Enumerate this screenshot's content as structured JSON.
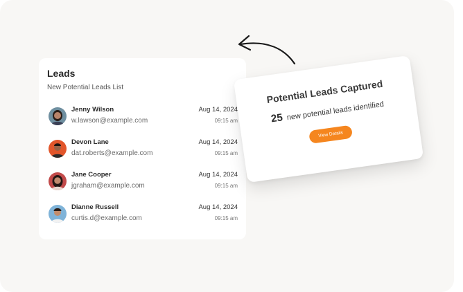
{
  "leads": {
    "title": "Leads",
    "subtitle": "New Potential Leads List",
    "rows": [
      {
        "name": "Jenny Wilson",
        "email": "w.lawson@example.com",
        "date": "Aug 14, 2024",
        "time": "09:15 am"
      },
      {
        "name": "Devon Lane",
        "email": "dat.roberts@example.com",
        "date": "Aug 14, 2024",
        "time": "09:15 am"
      },
      {
        "name": "Jane Cooper",
        "email": "jgraham@example.com",
        "date": "Aug 14, 2024",
        "time": "09:15 am"
      },
      {
        "name": "Dianne Russell",
        "email": "curtis.d@example.com",
        "date": "Aug 14, 2024",
        "time": "09:15 am"
      }
    ]
  },
  "capture": {
    "title": "Potential Leads Captured",
    "count": "25",
    "message": "new potential leads identified",
    "button_label": "View Details"
  },
  "colors": {
    "accent": "#f5861f",
    "background": "#f8f7f5"
  },
  "icons": {
    "arrow": "curved-arrow-left-icon"
  }
}
